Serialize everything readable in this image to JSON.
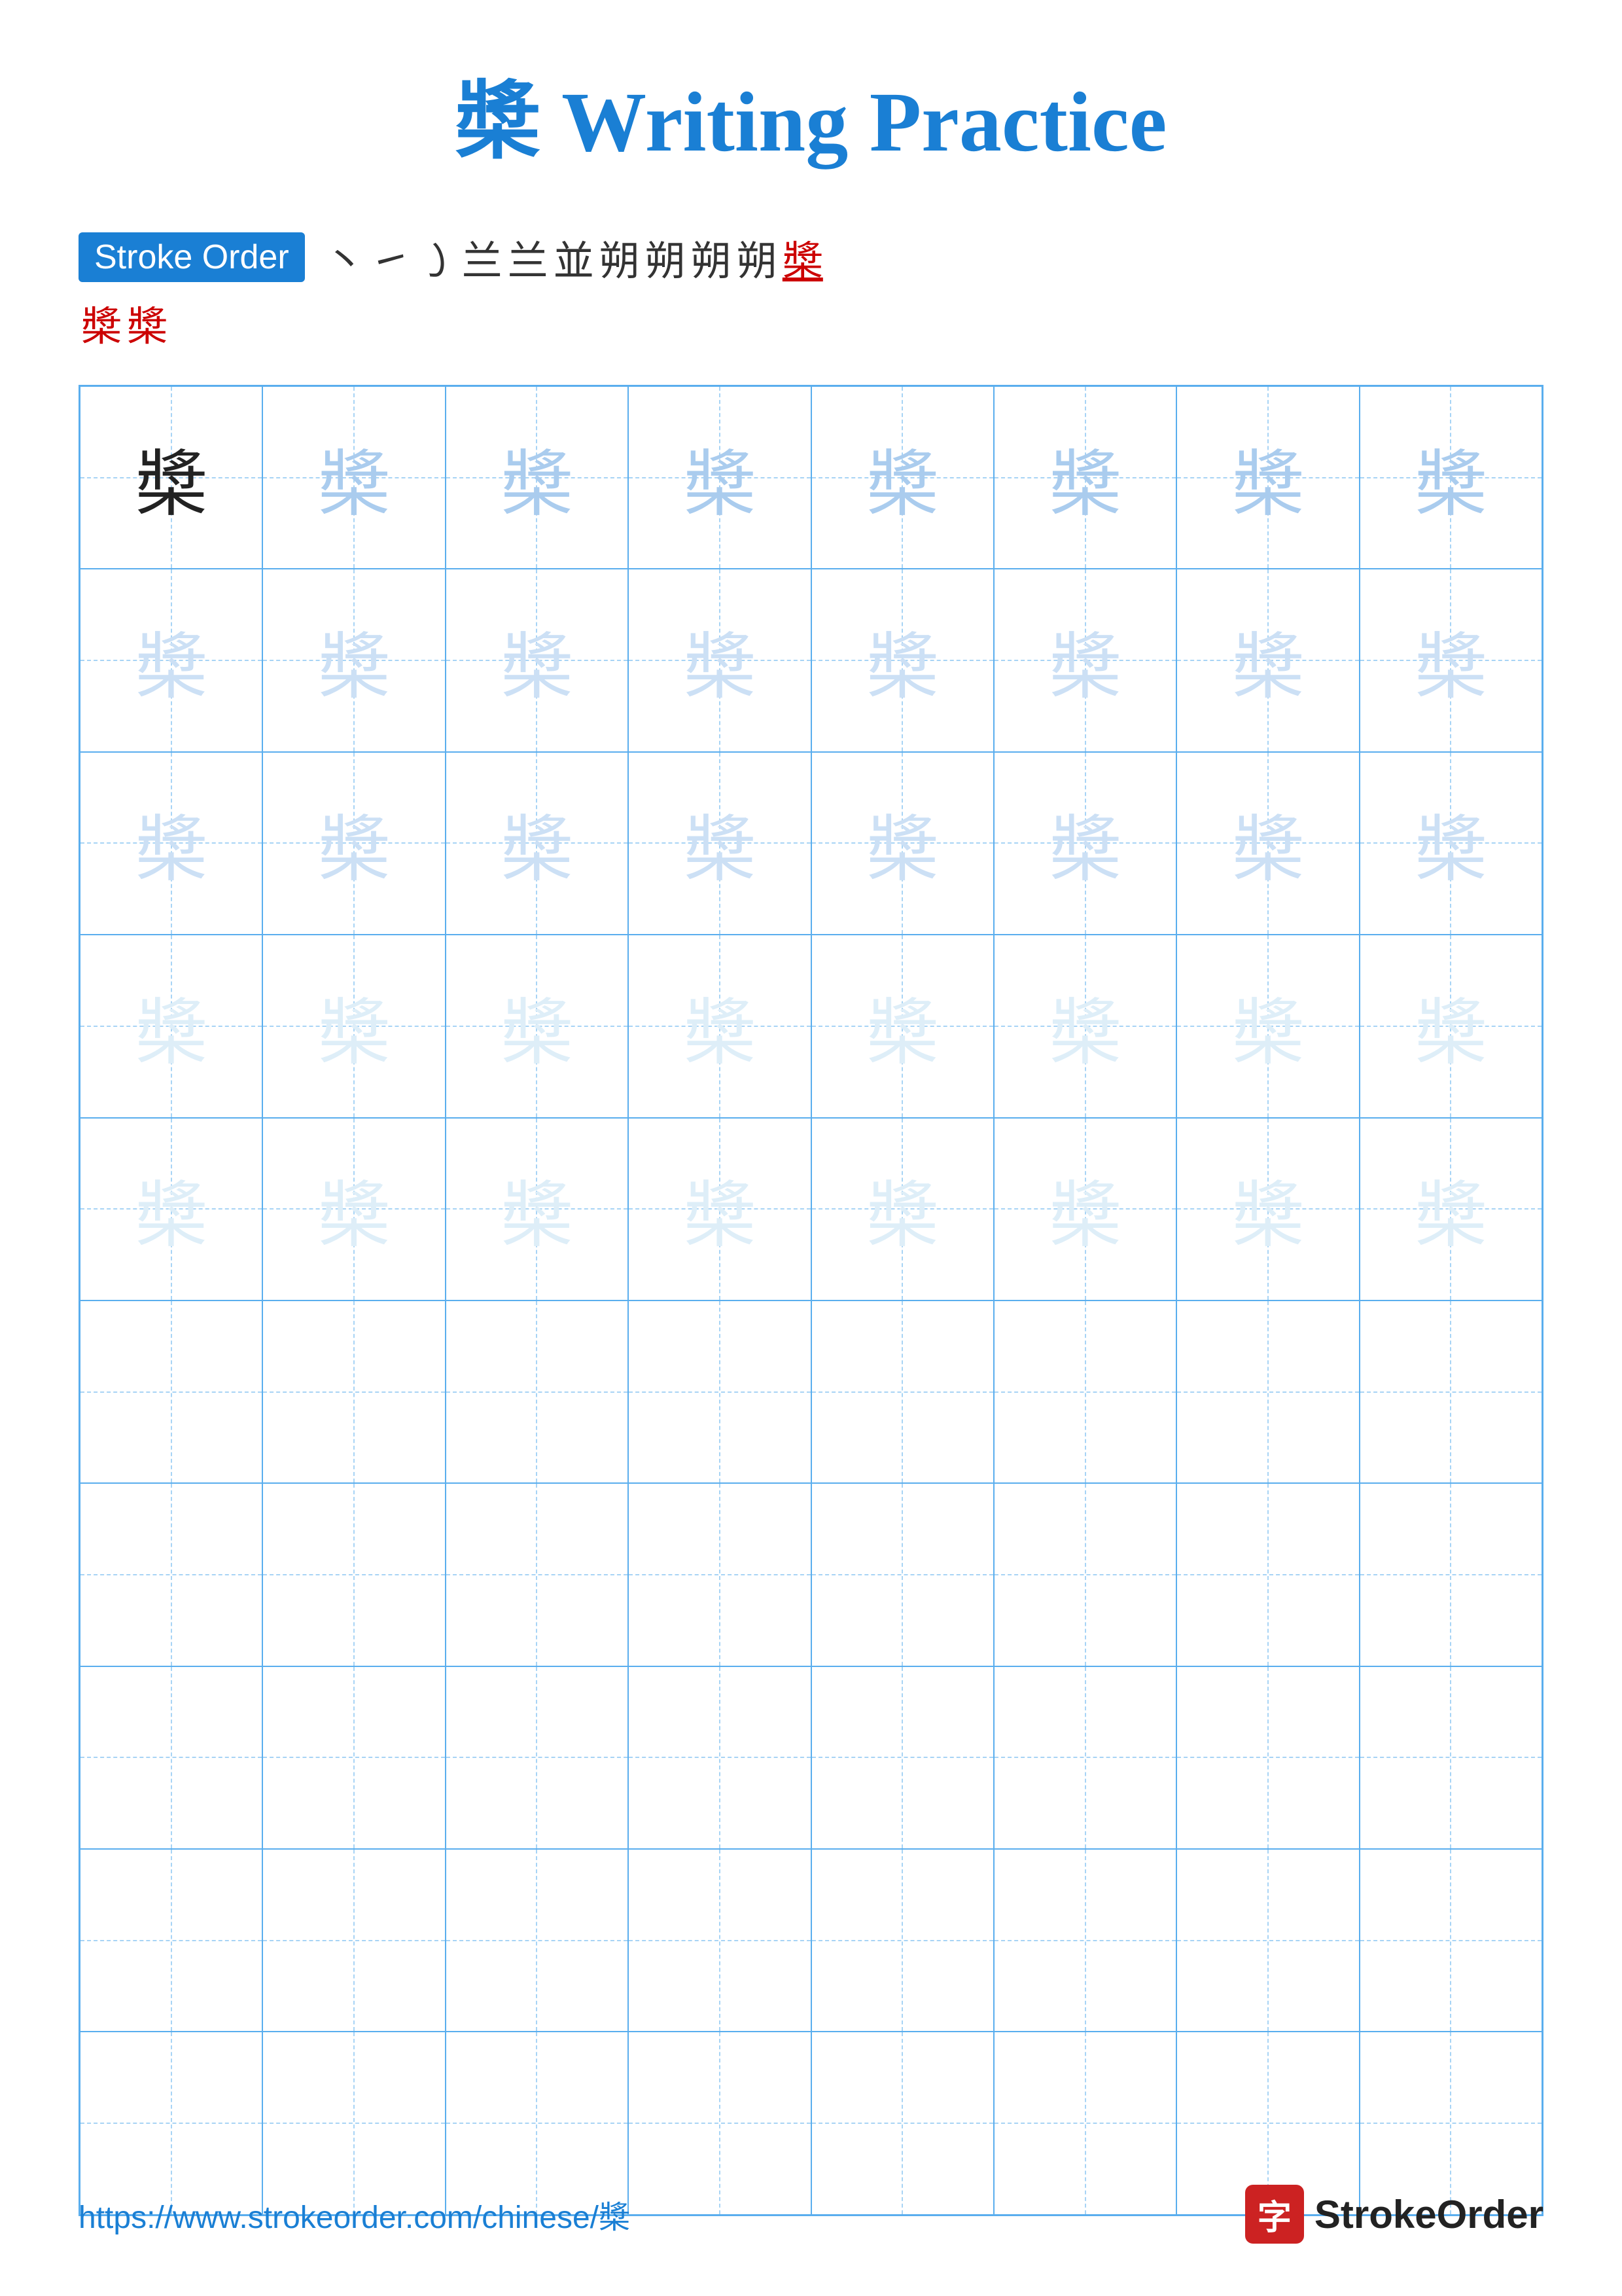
{
  "title": "槳 Writing Practice",
  "stroke_order": {
    "badge_label": "Stroke Order",
    "strokes_line1": [
      "丶",
      "㇀",
      "㇁",
      "兰",
      "兰",
      "並",
      "朔",
      "朔",
      "朔",
      "朔",
      "槳"
    ],
    "strokes_red_char": "槳",
    "strokes_line2": [
      "槳",
      "槳"
    ]
  },
  "grid": {
    "rows": 10,
    "cols": 8,
    "character": "槳",
    "guide_rows": 5,
    "empty_rows": 5
  },
  "footer": {
    "url": "https://www.strokeorder.com/chinese/槳",
    "logo_icon": "字",
    "logo_text": "StrokeOrder"
  }
}
